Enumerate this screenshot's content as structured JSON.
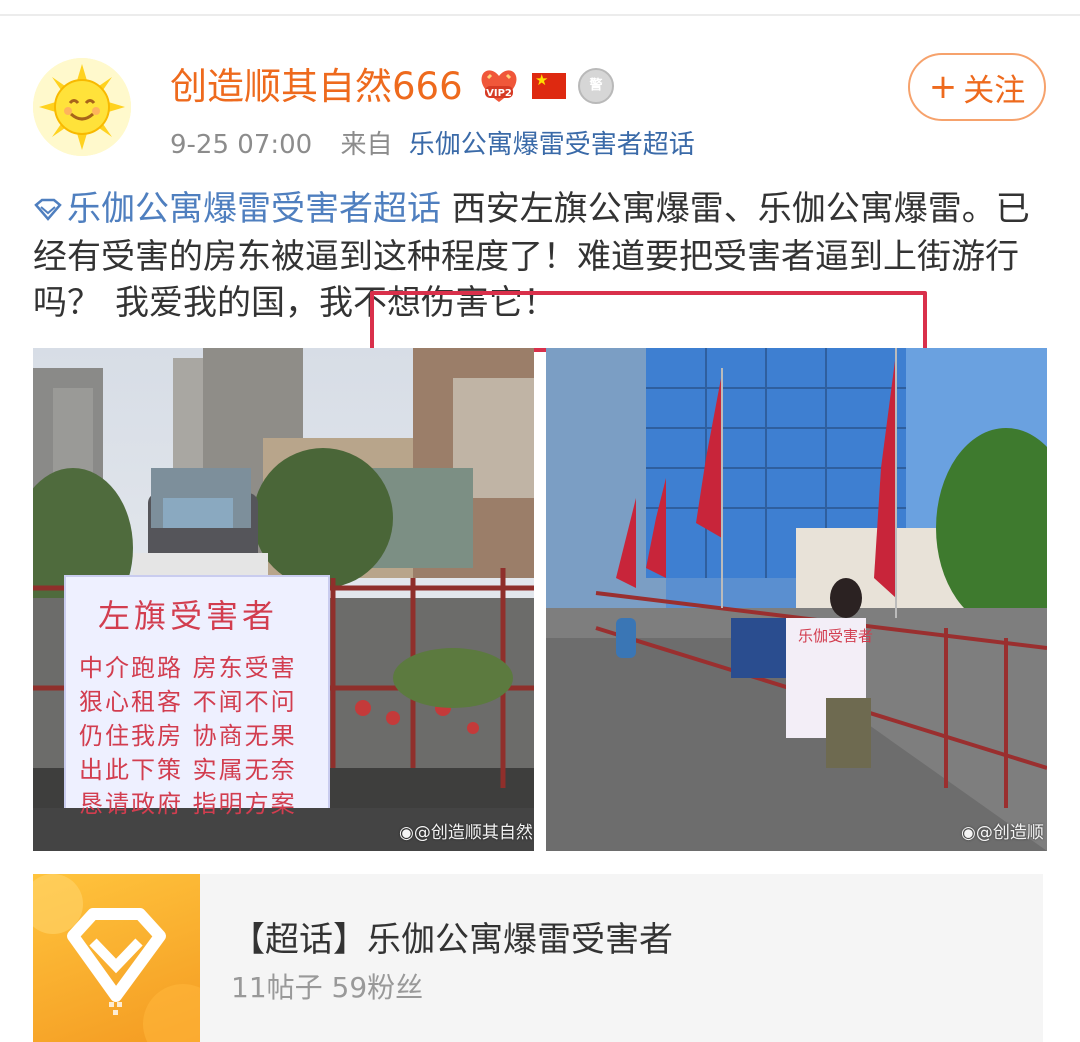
{
  "post": {
    "username": "创造顺其自然666",
    "vip_badge_text": "VIP2",
    "time": "9-25 07:00",
    "from_label": "来自",
    "source": "乐伽公寓爆雷受害者超话",
    "follow_label": "关注",
    "topic_link": "乐伽公寓爆雷受害者超话",
    "body_text": " 西安左旗公寓爆雷、乐伽公寓爆雷。已经有受害的房东被逼到这种程度了！难道要把受害者逼到上街游行吗？",
    "highlight_text": "我爱我的国，我不想伤害它！"
  },
  "images": [
    {
      "sign_title": "左旗受害者",
      "sign_lines": [
        "中介跑路 房东受害",
        "狠心租客 不闻不问",
        "仍住我房 协商无果",
        "出此下策 实属无奈",
        "恳请政府 指明方案"
      ],
      "watermark": "@创造顺其自然"
    },
    {
      "sign_title": "乐伽受害者",
      "watermark": "@创造顺"
    }
  ],
  "topic_card": {
    "title": "【超话】乐伽公寓爆雷受害者",
    "stats": "11帖子 59粉丝"
  },
  "colors": {
    "username": "#ee6a1d",
    "link": "#4f7fbf",
    "highlight_border": "#d9304b",
    "card_bg": "#f5f5f5"
  },
  "icons": [
    "sun-avatar-icon",
    "vip-heart-icon",
    "china-flag-icon",
    "medal-icon",
    "plus-icon",
    "supertopic-diamond-icon",
    "weibo-logo-icon"
  ]
}
